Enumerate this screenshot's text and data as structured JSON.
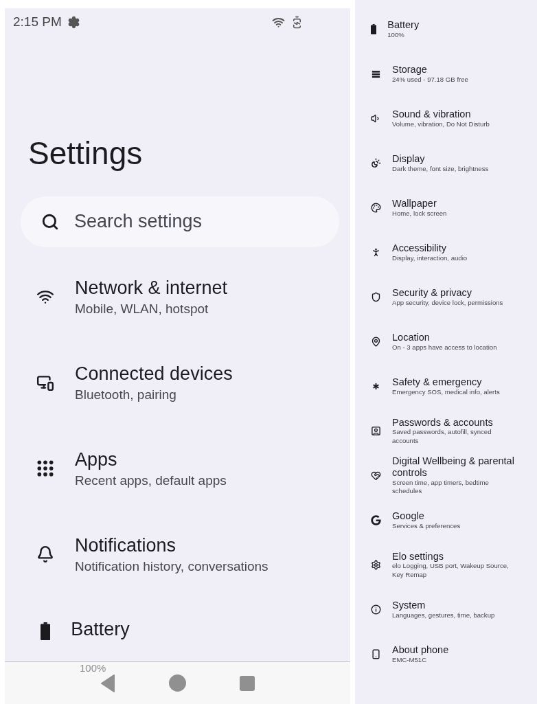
{
  "status_bar": {
    "time": "2:15 PM"
  },
  "title": "Settings",
  "search": {
    "placeholder": "Search settings"
  },
  "main_items": [
    {
      "kind": "wifi",
      "title": "Network & internet",
      "subtitle": "Mobile, WLAN, hotspot"
    },
    {
      "kind": "devices",
      "title": "Connected devices",
      "subtitle": "Bluetooth, pairing"
    },
    {
      "kind": "apps",
      "title": "Apps",
      "subtitle": "Recent apps, default apps"
    },
    {
      "kind": "bell",
      "title": "Notifications",
      "subtitle": "Notification history, conversations"
    },
    {
      "kind": "battery",
      "title": "Battery",
      "subtitle": "100%"
    }
  ],
  "side_items": [
    {
      "kind": "battery",
      "title": "Battery",
      "subtitle": "100%"
    },
    {
      "kind": "storage",
      "title": "Storage",
      "subtitle": "24% used - 97.18 GB free"
    },
    {
      "kind": "sound",
      "title": "Sound & vibration",
      "subtitle": "Volume, vibration, Do Not Disturb"
    },
    {
      "kind": "display",
      "title": "Display",
      "subtitle": "Dark theme, font size, brightness"
    },
    {
      "kind": "palette",
      "title": "Wallpaper",
      "subtitle": "Home, lock screen"
    },
    {
      "kind": "accessibility",
      "title": "Accessibility",
      "subtitle": "Display, interaction, audio"
    },
    {
      "kind": "shield",
      "title": "Security & privacy",
      "subtitle": "App security, device lock, permissions"
    },
    {
      "kind": "location",
      "title": "Location",
      "subtitle": "On - 3 apps have access to location"
    },
    {
      "kind": "asterisk",
      "title": "Safety & emergency",
      "subtitle": "Emergency SOS, medical info, alerts"
    },
    {
      "kind": "account",
      "title": "Passwords & accounts",
      "subtitle": "Saved passwords, autofill, synced accounts"
    },
    {
      "kind": "wellbeing",
      "title": "Digital Wellbeing & parental controls",
      "subtitle": "Screen time, app timers, bedtime schedules"
    },
    {
      "kind": "google",
      "title": "Google",
      "subtitle": "Services & preferences"
    },
    {
      "kind": "gear",
      "title": "Elo settings",
      "subtitle": "elo Logging, USB port, Wakeup Source, Key Remap"
    },
    {
      "kind": "info",
      "title": "System",
      "subtitle": "Languages, gestures, time, backup"
    },
    {
      "kind": "phone",
      "title": "About phone",
      "subtitle": "EMC-M51C"
    }
  ]
}
